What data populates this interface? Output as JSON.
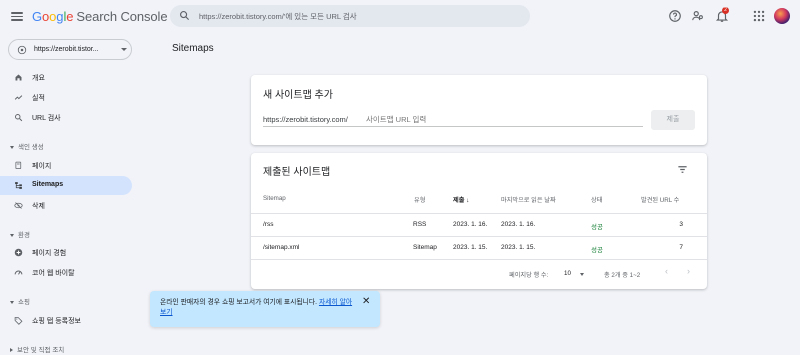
{
  "header": {
    "logo_google": [
      "G",
      "o",
      "o",
      "g",
      "l",
      "e"
    ],
    "product": "Search Console",
    "search_placeholder": "https://zerobit.tistory.com/'에 있는 모든 URL 검사",
    "notification_count": "2"
  },
  "sidebar": {
    "property": "https://zerobit.tistor...",
    "items_top": [
      {
        "label": "개요",
        "icon": "home-icon"
      },
      {
        "label": "실적",
        "icon": "trending-icon"
      },
      {
        "label": "URL 검사",
        "icon": "search-icon"
      }
    ],
    "section_index": "색인 생성",
    "items_index": [
      {
        "label": "페이지",
        "icon": "pages-icon"
      },
      {
        "label": "Sitemaps",
        "icon": "sitemap-icon",
        "active": true
      },
      {
        "label": "삭제",
        "icon": "removal-icon"
      }
    ],
    "section_experience": "환경",
    "items_experience": [
      {
        "label": "페이지 경험",
        "icon": "plus-circle-icon"
      },
      {
        "label": "코어 웹 바이탈",
        "icon": "speed-icon"
      }
    ],
    "section_shopping": "쇼핑",
    "items_shopping": [
      {
        "label": "쇼핑 탭 등록정보",
        "icon": "tag-icon"
      }
    ],
    "section_security": "보안 및 직접 조치"
  },
  "main": {
    "page_title": "Sitemaps",
    "add_card": {
      "title": "새 사이트맵 추가",
      "url_prefix": "https://zerobit.tistory.com/",
      "input_placeholder": "사이트맵 URL 입력",
      "submit_label": "제출"
    },
    "submitted_card": {
      "title": "제출된 사이트맵",
      "columns": [
        "Sitemap",
        "유형",
        "제출",
        "마지막으로 읽은 날짜",
        "상태",
        "발견된 URL 수"
      ],
      "rows": [
        {
          "sitemap": "/rss",
          "type": "RSS",
          "submitted": "2023. 1. 16.",
          "last_read": "2023. 1. 16.",
          "status": "성공",
          "urls": "3"
        },
        {
          "sitemap": "/sitemap.xml",
          "type": "Sitemap",
          "submitted": "2023. 1. 15.",
          "last_read": "2023. 1. 15.",
          "status": "성공",
          "urls": "7"
        }
      ],
      "rows_per_page_label": "페이지당 행 수:",
      "rows_per_page_value": "10",
      "range_label": "총 2개 중 1~2"
    }
  },
  "toast": {
    "message": "온라인 판매자의 경우 쇼핑 보고서가 여기에 표시됩니다.",
    "link": "자세히 알아보기"
  },
  "colors": {
    "active_bg": "#d3e3fd",
    "success": "#188038",
    "toast_bg": "#c2e7ff"
  }
}
